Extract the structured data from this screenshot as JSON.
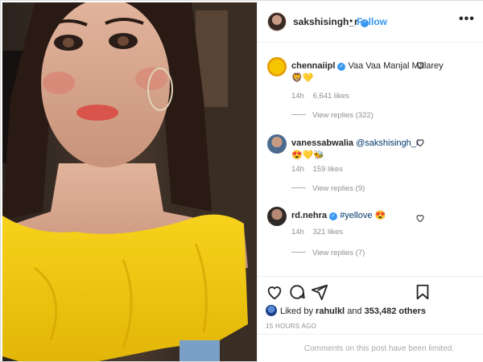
{
  "header": {
    "username": "sakshisingh_r",
    "separator": "•",
    "follow_label": "Follow",
    "more_glyph": "•••"
  },
  "comments": [
    {
      "username": "chennaiipl",
      "text": "Vaa Vaa Manjal Malarey",
      "emoji": "🦁💛",
      "time": "14h",
      "likes": "6,641 likes",
      "replies": "View replies (322)",
      "verified": true
    },
    {
      "username": "vanessabwalia",
      "mention": "@sakshisingh_r",
      "emoji": "😍💛🐝",
      "time": "14h",
      "likes": "159 likes",
      "replies": "View replies (9)",
      "verified": false
    },
    {
      "username": "rd.nehra",
      "text": "#yellove",
      "emoji": "😍",
      "time": "14h",
      "likes": "321 likes",
      "replies": "View replies (7)",
      "verified": true
    }
  ],
  "actions": {
    "like_icon": "heart-icon",
    "comment_icon": "comment-icon",
    "share_icon": "share-icon",
    "save_icon": "bookmark-icon"
  },
  "likes_summary": {
    "prefix": "Liked by",
    "user": "rahulkl",
    "middle": "and",
    "count": "353,482 others"
  },
  "timestamp": "15 HOURS AGO",
  "comments_limited": "Comments on this post have been limited.",
  "colors": {
    "link_blue": "#3897f0",
    "secondary_text": "#8e8e8e",
    "border": "#efefef"
  }
}
